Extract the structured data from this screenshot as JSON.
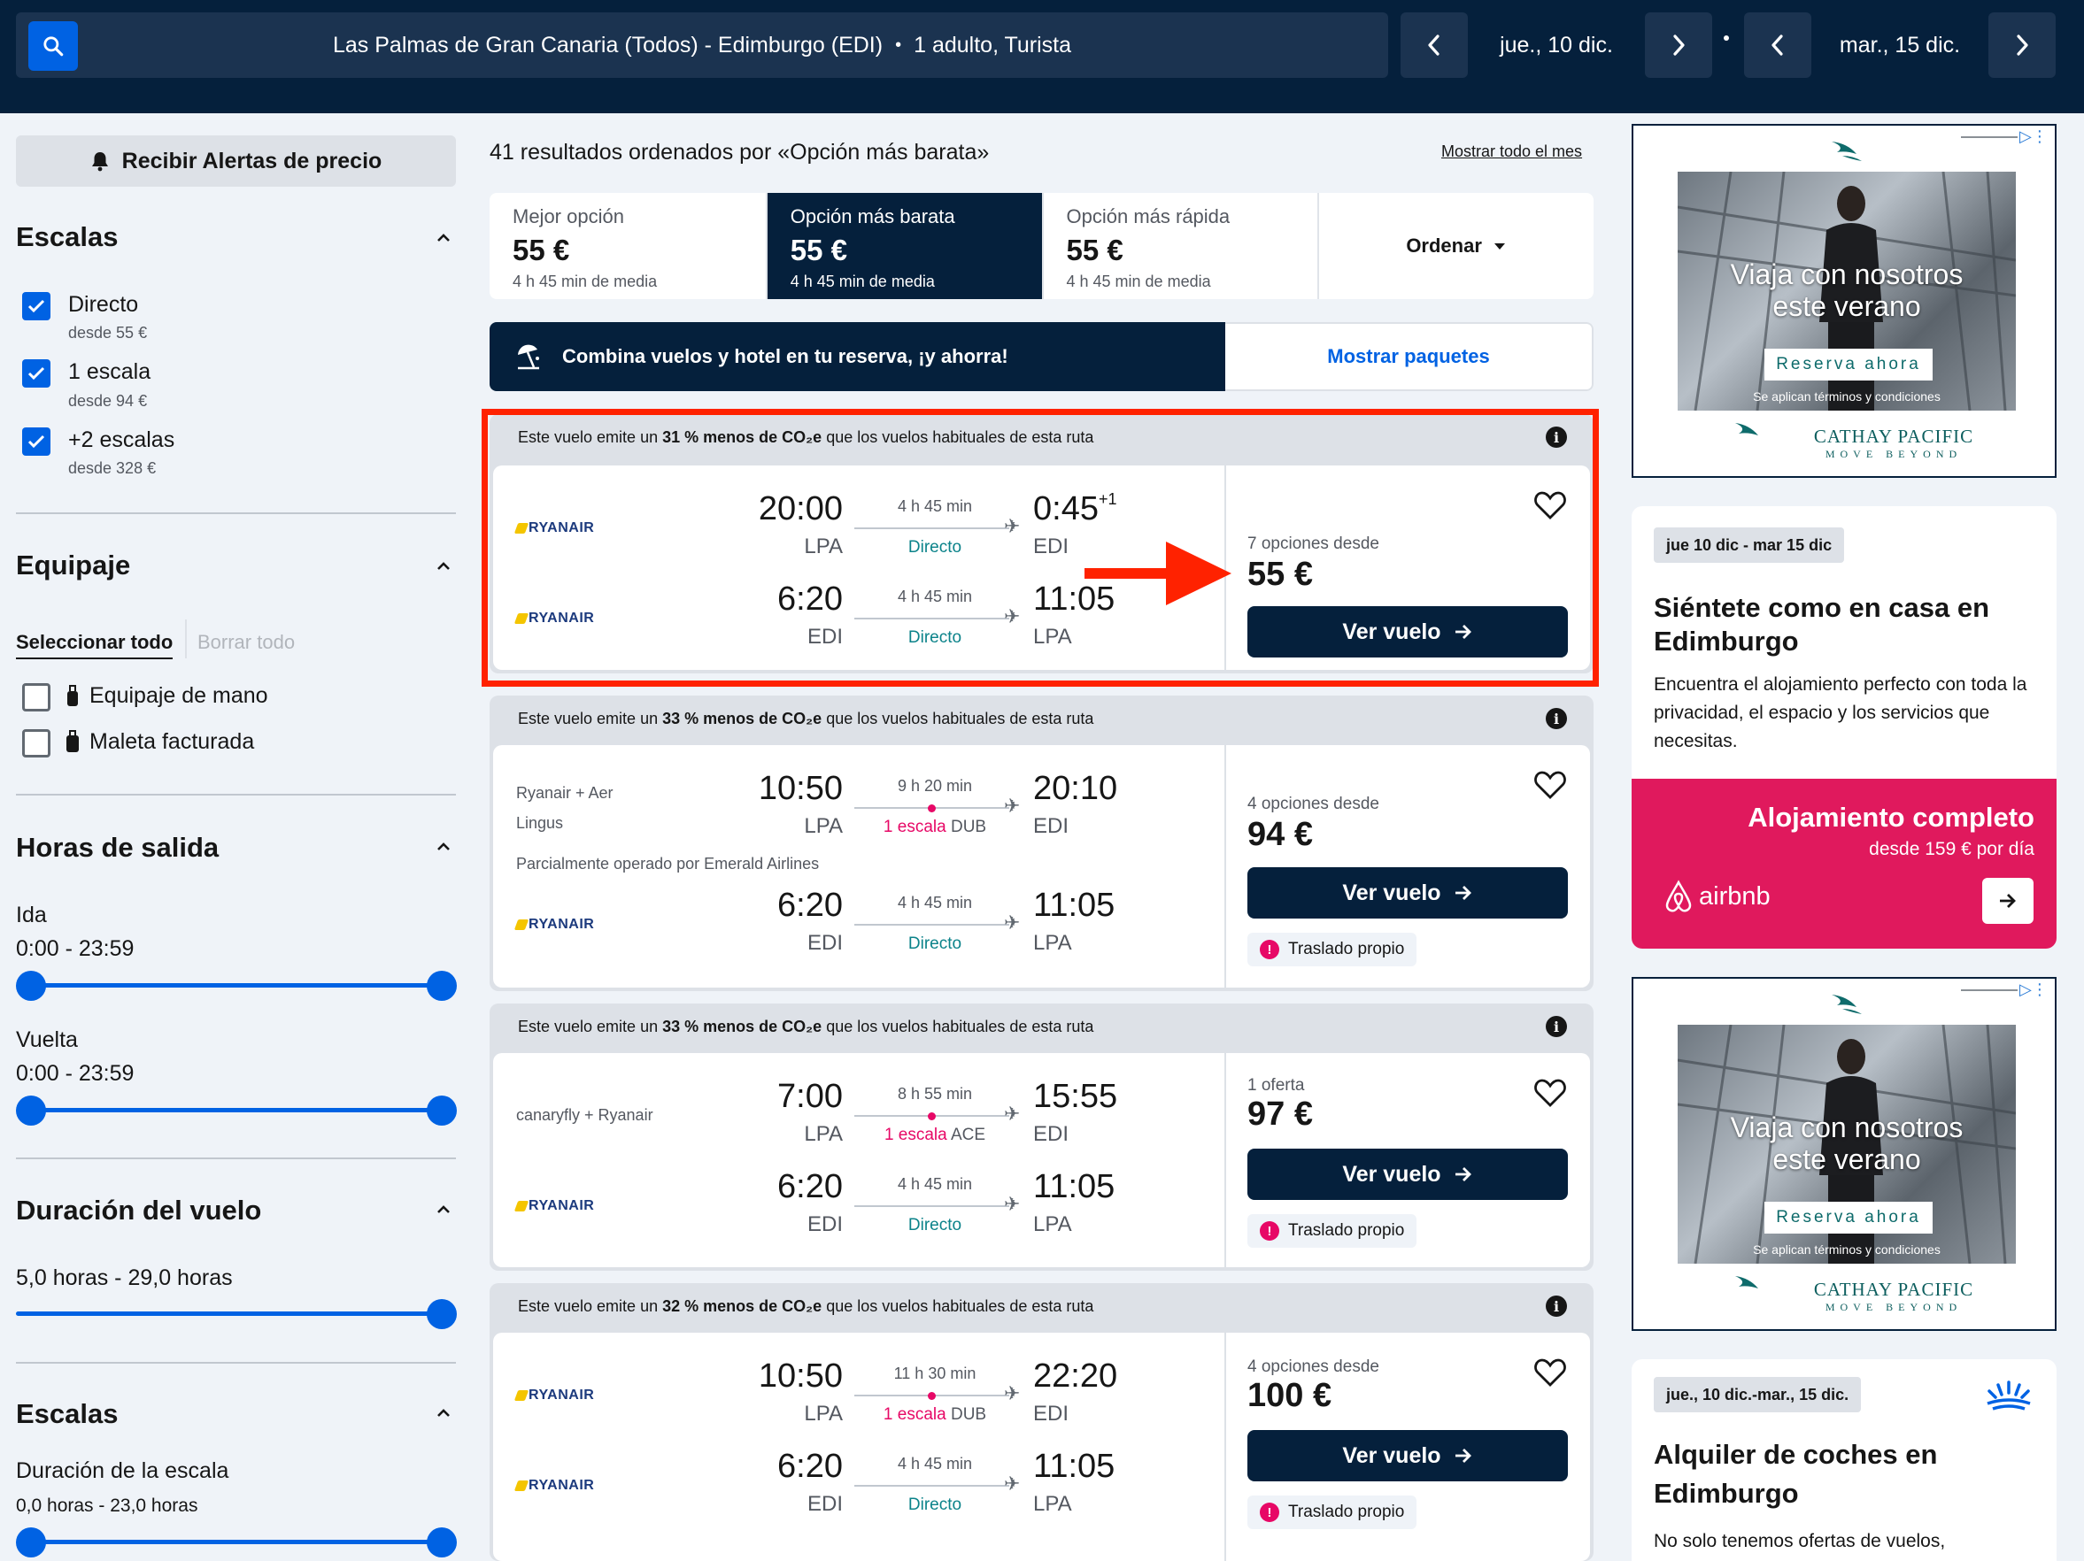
{
  "search": {
    "route": "Las Palmas de Gran Canaria (Todos) - Edimburgo (EDI)",
    "passengers": "1 adulto, Turista",
    "outbound_date": "jue., 10 dic.",
    "return_date": "mar., 15 dic."
  },
  "sidebar": {
    "price_alert": "Recibir Alertas de precio",
    "stops_title": "Escalas",
    "stops": [
      {
        "label": "Directo",
        "sub": "desde 55 €",
        "checked": true
      },
      {
        "label": "1 escala",
        "sub": "desde 94 €",
        "checked": true
      },
      {
        "label": "+2 escalas",
        "sub": "desde 328 €",
        "checked": true
      }
    ],
    "baggage_title": "Equipaje",
    "select_all": "Seleccionar todo",
    "clear_all": "Borrar todo",
    "baggage": [
      {
        "label": "Equipaje de mano",
        "checked": false
      },
      {
        "label": "Maleta facturada",
        "checked": false
      }
    ],
    "times_title": "Horas de salida",
    "outbound_label": "Ida",
    "outbound_range": "0:00 - 23:59",
    "return_label": "Vuelta",
    "return_range": "0:00 - 23:59",
    "duration_title": "Duración del vuelo",
    "duration_range": "5,0 horas - 29,0 horas",
    "layover_title": "Escalas",
    "layover_label": "Duración de la escala",
    "layover_range": "0,0 horas - 23,0 horas"
  },
  "results": {
    "summary": "41 resultados ordenados por «Opción más barata»",
    "month_link": "Mostrar todo el mes",
    "tabs": [
      {
        "label": "Mejor opción",
        "price": "55 €",
        "sub": "4 h 45 min de media"
      },
      {
        "label": "Opción más barata",
        "price": "55 €",
        "sub": "4 h 45 min de media"
      },
      {
        "label": "Opción más rápida",
        "price": "55 €",
        "sub": "4 h 45 min de media"
      }
    ],
    "sort_label": "Ordenar",
    "promo_text": "Combina vuelos y hotel en tu reserva, ¡y ahorra!",
    "promo_button": "Mostrar paquetes",
    "view_button": "Ver vuelo",
    "self_transfer": "Traslado propio",
    "eco_prefix": "Este vuelo emite un",
    "eco_suffix": "que los vuelos habituales de esta ruta",
    "cards": [
      {
        "eco_pct": "31 % menos de CO₂e",
        "airline_out": "RYANAIR",
        "airline_ret": "RYANAIR",
        "out": {
          "dep": "20:00",
          "dep_code": "LPA",
          "arr": "0:45",
          "arr_plus": "+1",
          "arr_code": "EDI",
          "dur": "4 h 45 min",
          "stops": "Directo"
        },
        "ret": {
          "dep": "6:20",
          "dep_code": "EDI",
          "arr": "11:05",
          "arr_code": "LPA",
          "dur": "4 h 45 min",
          "stops": "Directo"
        },
        "options": "7 opciones desde",
        "price": "55 €"
      },
      {
        "eco_pct": "33 % menos de CO₂e",
        "airline_out_1": "Ryanair + Aer",
        "airline_out_2": "Lingus",
        "operated": "Parcialmente operado por Emerald Airlines",
        "airline_ret": "RYANAIR",
        "out": {
          "dep": "10:50",
          "dep_code": "LPA",
          "arr": "20:10",
          "arr_code": "EDI",
          "dur": "9 h 20 min",
          "stop_label": "1 escala",
          "stop_code": "DUB"
        },
        "ret": {
          "dep": "6:20",
          "dep_code": "EDI",
          "arr": "11:05",
          "arr_code": "LPA",
          "dur": "4 h 45 min",
          "stops": "Directo"
        },
        "options": "4 opciones desde",
        "price": "94 €"
      },
      {
        "eco_pct": "33 % menos de CO₂e",
        "airline_out": "canaryfly + Ryanair",
        "airline_ret": "RYANAIR",
        "out": {
          "dep": "7:00",
          "dep_code": "LPA",
          "arr": "15:55",
          "arr_code": "EDI",
          "dur": "8 h 55 min",
          "stop_label": "1 escala",
          "stop_code": "ACE"
        },
        "ret": {
          "dep": "6:20",
          "dep_code": "EDI",
          "arr": "11:05",
          "arr_code": "LPA",
          "dur": "4 h 45 min",
          "stops": "Directo"
        },
        "options": "1 oferta",
        "price": "97 €"
      },
      {
        "eco_pct": "32 % menos de CO₂e",
        "airline_out": "RYANAIR",
        "airline_ret": "RYANAIR",
        "out": {
          "dep": "10:50",
          "dep_code": "LPA",
          "arr": "22:20",
          "arr_code": "EDI",
          "dur": "11 h 30 min",
          "stop_label": "1 escala",
          "stop_code": "DUB"
        },
        "ret": {
          "dep": "6:20",
          "dep_code": "EDI",
          "arr": "11:05",
          "arr_code": "LPA",
          "dur": "4 h 45 min",
          "stops": "Directo"
        },
        "options": "4 opciones desde",
        "price": "100 €"
      }
    ]
  },
  "ads": {
    "cathay_title_1": "Viaja con nosotros",
    "cathay_title_2": "este verano",
    "cathay_button": "Reserva ahora",
    "cathay_terms": "Se aplican términos y condiciones",
    "cathay_brand": "CATHAY PACIFIC",
    "cathay_tagline": "MOVE BEYOND",
    "airbnb_dates": "jue 10 dic - mar 15 dic",
    "airbnb_title": "Siéntete como en casa en Edimburgo",
    "airbnb_body": "Encuentra el alojamiento perfecto con toda la privacidad, el espacio y los servicios que necesitas.",
    "airbnb_cta": "Alojamiento completo",
    "airbnb_price": "desde 159 € por día",
    "airbnb_brand": "airbnb",
    "car_dates": "jue., 10 dic.-mar., 15 dic.",
    "car_title": "Alquiler de coches en Edimburgo",
    "car_body": "No solo tenemos ofertas de vuelos,"
  },
  "colors": {
    "navy": "#05203c",
    "blue": "#0062e3",
    "highlight": "#ff2200",
    "pink": "#e70866"
  }
}
